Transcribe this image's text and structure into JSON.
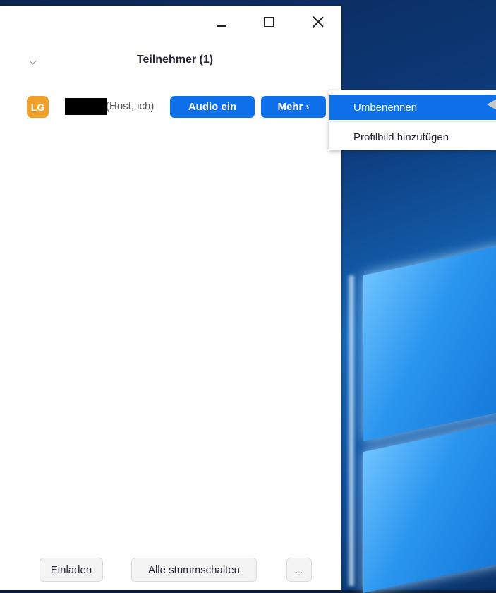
{
  "window": {
    "title": "Teilnehmer (1)"
  },
  "participant": {
    "avatar_initials": "LG",
    "role_label": "(Host, ich)",
    "audio_button": "Audio ein",
    "more_button": "Mehr ›"
  },
  "context_menu": {
    "items": [
      {
        "label": "Umbenennen"
      },
      {
        "label": "Profilbild hinzufügen"
      }
    ]
  },
  "footer": {
    "invite_label": "Einladen",
    "mute_all_label": "Alle stummschalten",
    "more_label": "..."
  },
  "colors": {
    "accent": "#0e71eb",
    "avatar": "#f0a02a"
  },
  "icons": [
    "minimize-icon",
    "maximize-icon",
    "close-icon",
    "chevron-down-icon"
  ]
}
